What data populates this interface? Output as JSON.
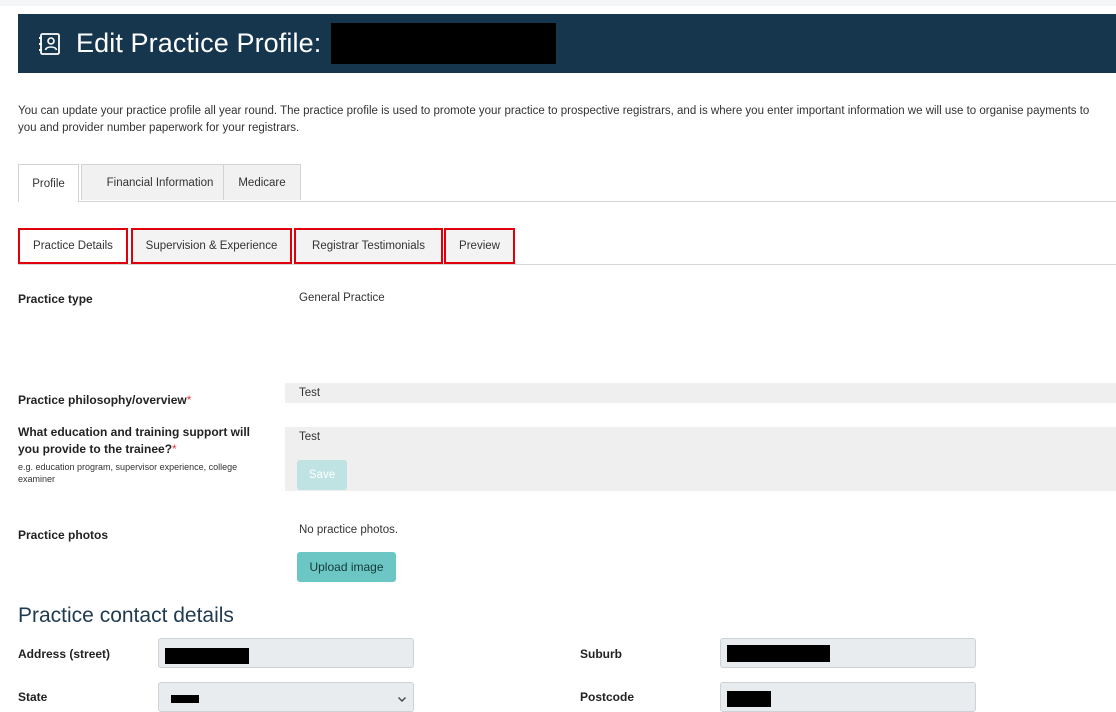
{
  "header": {
    "title": "Edit Practice Profile:",
    "icon": "profile-card-icon",
    "background": "#16364e"
  },
  "intro": "You can update your practice profile all year round. The practice profile is used to promote your practice to prospective registrars, and is where you enter important information we will use to organise payments to you and provider number paperwork for your registrars.",
  "main_tabs": [
    {
      "label": "Profile",
      "active": true
    },
    {
      "label": "Financial Information",
      "active": false
    },
    {
      "label": "Medicare",
      "active": false
    }
  ],
  "sub_tabs": [
    {
      "label": "Practice Details",
      "active": true
    },
    {
      "label": "Supervision & Experience",
      "active": false
    },
    {
      "label": "Registrar Testimonials",
      "active": false
    },
    {
      "label": "Preview",
      "active": false
    }
  ],
  "fields": {
    "practice_type": {
      "label": "Practice type",
      "value": "General Practice"
    },
    "philosophy": {
      "label": "Practice philosophy/overview",
      "required_mark": "*",
      "value": "Test"
    },
    "education": {
      "label": "What education and training support will you provide to the trainee?",
      "required_mark": "*",
      "help": "e.g. education program, supervisor experience, college examiner",
      "value": "Test",
      "save_label": "Save"
    },
    "photos": {
      "label": "Practice photos",
      "value": "No practice photos.",
      "upload_label": "Upload image"
    }
  },
  "contact": {
    "title": "Practice contact details",
    "address_label": "Address (street)",
    "suburb_label": "Suburb",
    "state_label": "State",
    "postcode_label": "Postcode"
  },
  "colors": {
    "accent": "#6cc6c4",
    "highlight": "#e0000b",
    "required": "#e0393e"
  }
}
